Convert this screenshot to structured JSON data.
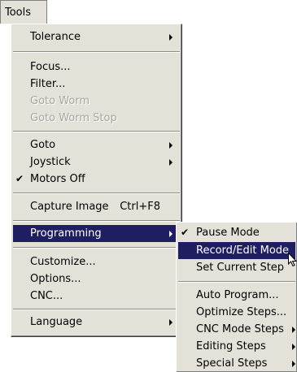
{
  "menubar": {
    "tools_label": "Tools"
  },
  "tools_menu": {
    "tolerance": "Tolerance",
    "focus": "Focus...",
    "filter": "Filter...",
    "goto_worm": "Goto Worm",
    "goto_worm_stop": "Goto Worm Stop",
    "goto": "Goto",
    "joystick": "Joystick",
    "motors_off": "Motors Off",
    "capture_image": "Capture Image",
    "capture_image_shortcut": "Ctrl+F8",
    "programming": "Programming",
    "customize": "Customize...",
    "options": "Options...",
    "cnc": "CNC...",
    "language": "Language",
    "check_mark": "✔"
  },
  "programming_menu": {
    "pause_mode": "Pause Mode",
    "record_edit_mode": "Record/Edit Mode",
    "set_current_step": "Set Current Step",
    "auto_program": "Auto Program...",
    "optimize_steps": "Optimize Steps...",
    "cnc_mode_steps": "CNC Mode Steps",
    "editing_steps": "Editing Steps",
    "special_steps": "Special Steps",
    "check_mark": "✔"
  },
  "colors": {
    "menu_bg": "#e4e1d9",
    "highlight": "#1f1e63",
    "disabled_text": "#a9a69e"
  }
}
